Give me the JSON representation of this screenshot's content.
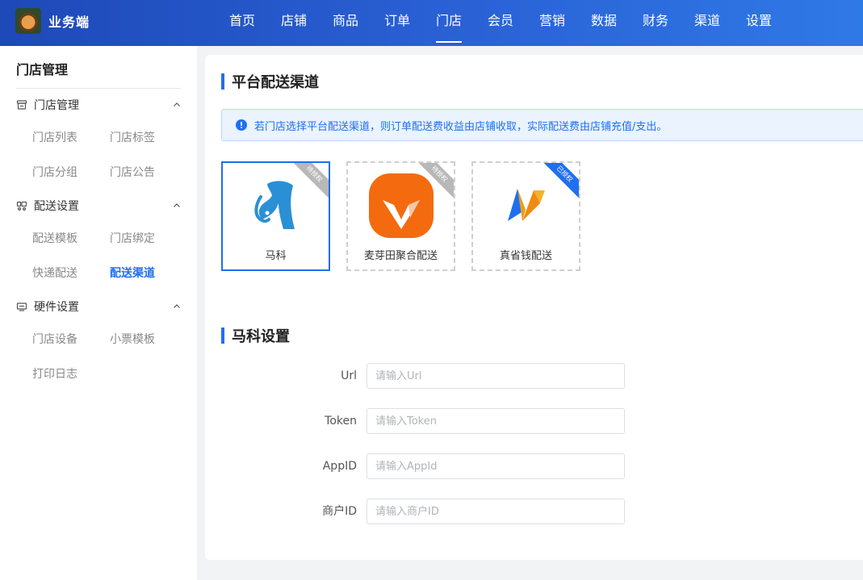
{
  "header": {
    "brand": "业务端",
    "nav": [
      "首页",
      "店铺",
      "商品",
      "订单",
      "门店",
      "会员",
      "营销",
      "数据",
      "财务",
      "渠道",
      "设置"
    ],
    "active_nav": 4
  },
  "sidebar": {
    "title": "门店管理",
    "groups": [
      {
        "label": "门店管理",
        "icon": "store-icon",
        "items": [
          "门店列表",
          "门店标签",
          "门店分组",
          "门店公告"
        ]
      },
      {
        "label": "配送设置",
        "icon": "delivery-icon",
        "items": [
          "配送模板",
          "门店绑定",
          "快递配送",
          "配送渠道"
        ]
      },
      {
        "label": "硬件设置",
        "icon": "printer-icon",
        "items": [
          "门店设备",
          "小票模板",
          "打印日志"
        ]
      }
    ],
    "active_item": "配送渠道"
  },
  "main": {
    "section1_title": "平台配送渠道",
    "notice": "若门店选择平台配送渠道，则订单配送费收益由店铺收取，实际配送费由店铺充值/支出。",
    "channels": [
      {
        "name": "马科",
        "ribbon": "待授权",
        "selected": true,
        "ribbon_color": "#b8b8b8"
      },
      {
        "name": "麦芽田聚合配送",
        "ribbon": "待授权",
        "selected": false,
        "ribbon_color": "#b8b8b8"
      },
      {
        "name": "真省钱配送",
        "ribbon": "已授权",
        "selected": false,
        "ribbon_color": "#1f6ff0"
      }
    ],
    "section2_title": "马科设置",
    "form": [
      {
        "label": "Url",
        "placeholder": "请输入Url",
        "value": ""
      },
      {
        "label": "Token",
        "placeholder": "请输入Token",
        "value": ""
      },
      {
        "label": "AppID",
        "placeholder": "请输入AppId",
        "value": ""
      },
      {
        "label": "商户ID",
        "placeholder": "请输入商户ID",
        "value": ""
      }
    ]
  },
  "colors": {
    "accent": "#1f6ff0",
    "header_start": "#1e49b8",
    "header_end": "#2f79e6"
  }
}
